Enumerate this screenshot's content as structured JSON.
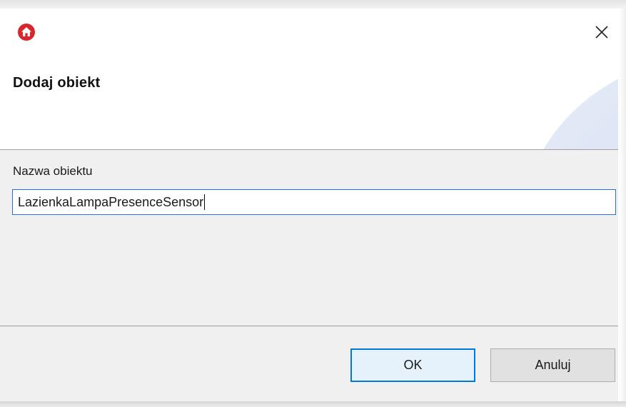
{
  "window": {
    "title": "Dodaj obiekt",
    "app_icon": "home-app-icon",
    "close_icon": "close-icon",
    "close_glyph": "✕"
  },
  "form": {
    "name_label": "Nazwa obiektu",
    "name_value": "LazienkaLampaPresenceSensor"
  },
  "buttons": {
    "ok_label": "OK",
    "cancel_label": "Anuluj"
  },
  "colors": {
    "app_icon_red": "#d9262e",
    "focus_blue": "#0078d7",
    "panel_gray": "#f0f0f0"
  }
}
